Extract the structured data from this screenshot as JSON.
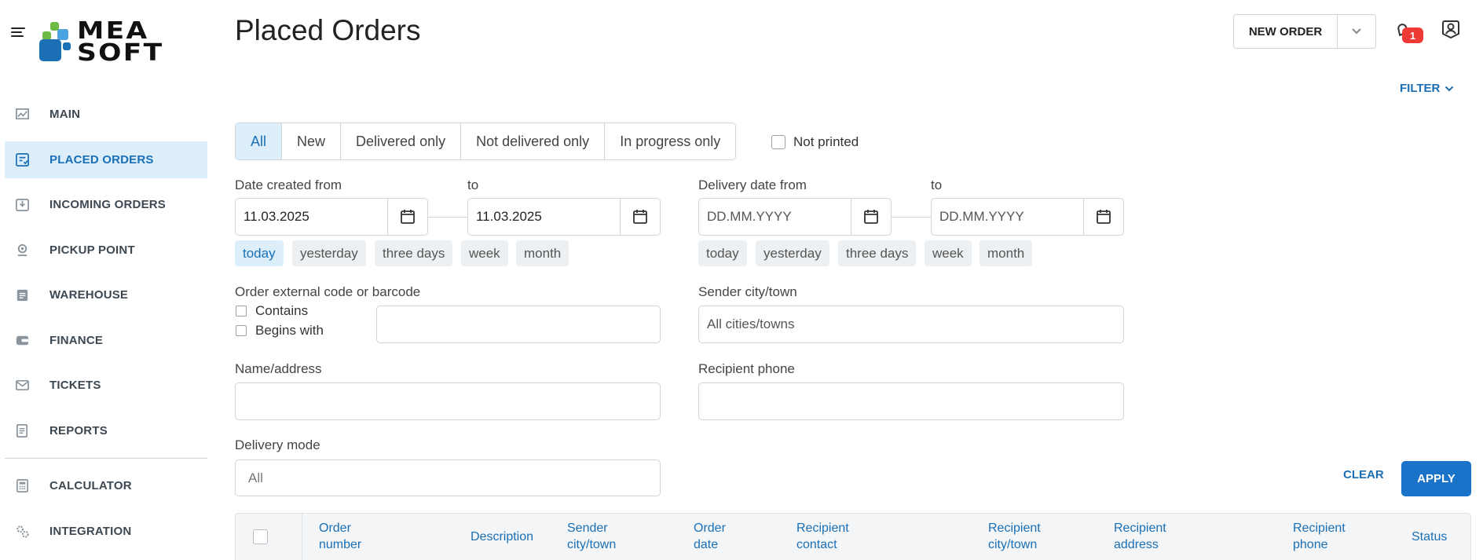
{
  "brand": {
    "line1": "MEA",
    "line2": "SOFT"
  },
  "sidebar": {
    "items": [
      {
        "label": "MAIN",
        "icon": "chart-icon"
      },
      {
        "label": "PLACED ORDERS",
        "icon": "orders-icon"
      },
      {
        "label": "INCOMING ORDERS",
        "icon": "inbox-icon"
      },
      {
        "label": "PICKUP POINT",
        "icon": "location-icon"
      },
      {
        "label": "WAREHOUSE",
        "icon": "clipboard-icon"
      },
      {
        "label": "FINANCE",
        "icon": "wallet-icon"
      },
      {
        "label": "TICKETS",
        "icon": "envelope-icon"
      },
      {
        "label": "REPORTS",
        "icon": "report-icon"
      },
      {
        "label": "CALCULATOR",
        "icon": "calculator-icon"
      },
      {
        "label": "INTEGRATION",
        "icon": "gears-icon"
      }
    ],
    "active_index": 1
  },
  "header": {
    "title": "Placed Orders",
    "new_order_label": "NEW ORDER",
    "notification_count": "1",
    "filter_label": "FILTER"
  },
  "filters": {
    "status_tabs": [
      "All",
      "New",
      "Delivered only",
      "Not delivered only",
      "In progress only"
    ],
    "status_active": 0,
    "not_printed_label": "Not printed",
    "date_created_from_label": "Date created from",
    "date_created_to_label": "to",
    "date_created_from_value": "11.03.2025",
    "date_created_to_value": "11.03.2025",
    "delivery_date_from_label": "Delivery date from",
    "delivery_date_to_label": "to",
    "delivery_date_placeholder": "DD.MM.YYYY",
    "quick_ranges": [
      "today",
      "yesterday",
      "three days",
      "week",
      "month"
    ],
    "code_label": "Order external code or barcode",
    "contains_label": "Contains",
    "begins_with_label": "Begins with",
    "sender_city_label": "Sender city/town",
    "sender_city_placeholder": "All cities/towns",
    "name_address_label": "Name/address",
    "recipient_phone_label": "Recipient phone",
    "delivery_mode_label": "Delivery mode",
    "delivery_mode_value": "All",
    "clear_label": "CLEAR",
    "apply_label": "APPLY"
  },
  "table": {
    "columns": [
      [
        "Order",
        "number"
      ],
      [
        "Description"
      ],
      [
        "Sender",
        "city/town"
      ],
      [
        "Order",
        "date"
      ],
      [
        "Recipient",
        "contact"
      ],
      [
        "Recipient",
        "city/town"
      ],
      [
        "Recipient",
        "address"
      ],
      [
        "Recipient",
        "phone"
      ],
      [
        "Status"
      ]
    ]
  },
  "colors": {
    "accent": "#1a73c8",
    "active_bg": "#ddeefb",
    "badge": "#ef3b36"
  }
}
